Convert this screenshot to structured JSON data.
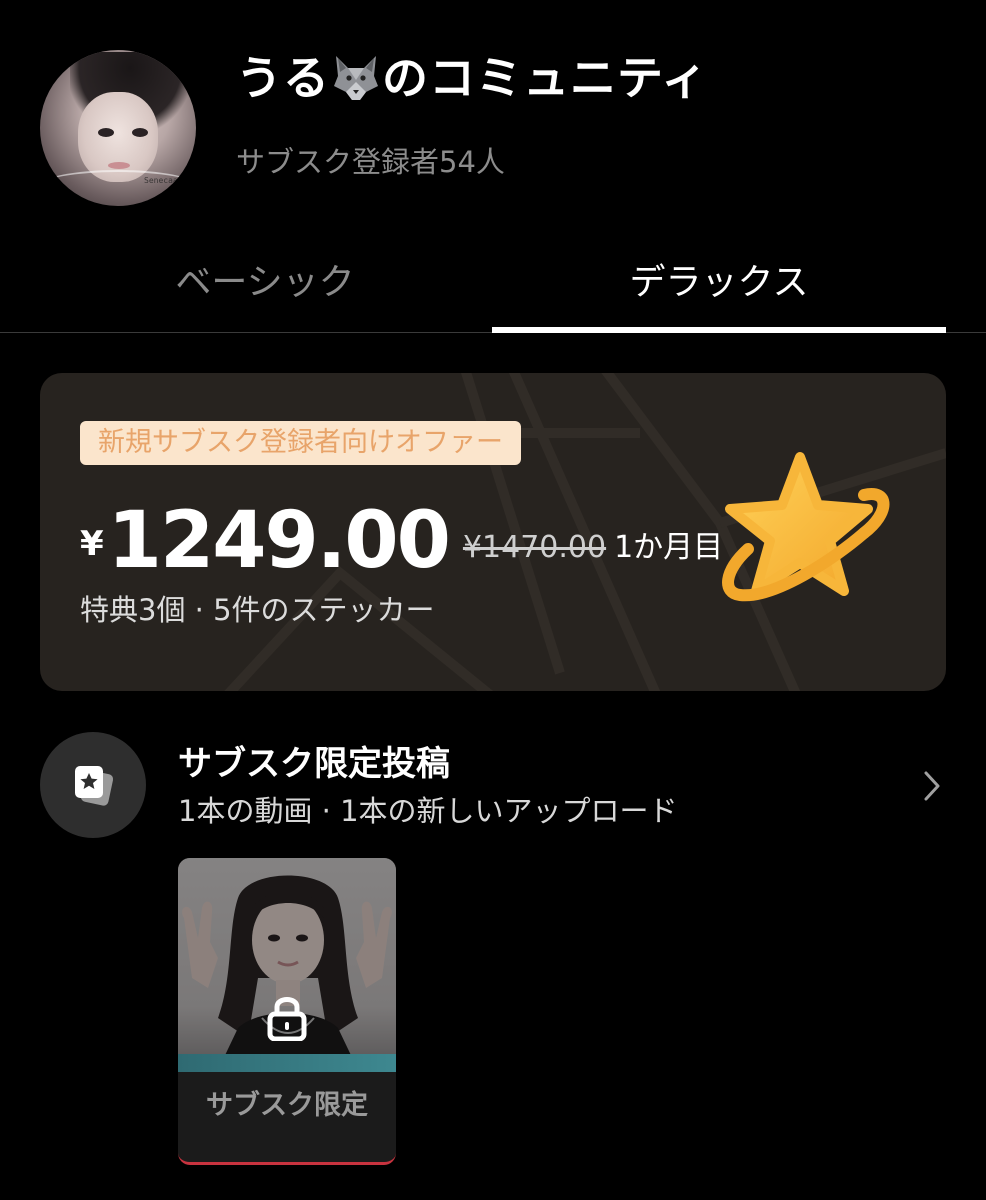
{
  "header": {
    "title_prefix": "うる",
    "title_emoji": "🐺",
    "title_suffix": "のコミュニティ",
    "subscribers": "サブスク登録者54人",
    "avatar_tag": "Senecaal"
  },
  "tabs": [
    {
      "label": "ベーシック",
      "selected": false
    },
    {
      "label": "デラックス",
      "selected": true
    }
  ],
  "offer": {
    "badge": "新規サブスク登録者向けオファー",
    "currency": "¥",
    "price": "1249.00",
    "original_price": "¥1470.00",
    "period": "1か月目",
    "benefits": "特典3個 · 5件のステッカー",
    "icon": "star-orbit-icon",
    "colors": {
      "card_bg": "#27231f",
      "badge_bg": "#fbe5cc",
      "badge_text": "#e8a46a",
      "star": "#f6b333"
    }
  },
  "exclusive_posts": {
    "title": "サブスク限定投稿",
    "subtitle": "1本の動画 · 1本の新しいアップロード",
    "icon": "star-cards-icon",
    "chevron": "chevron-right-icon"
  },
  "video_card": {
    "label": "サブスク限定",
    "icon": "lock-icon",
    "locked": true
  }
}
